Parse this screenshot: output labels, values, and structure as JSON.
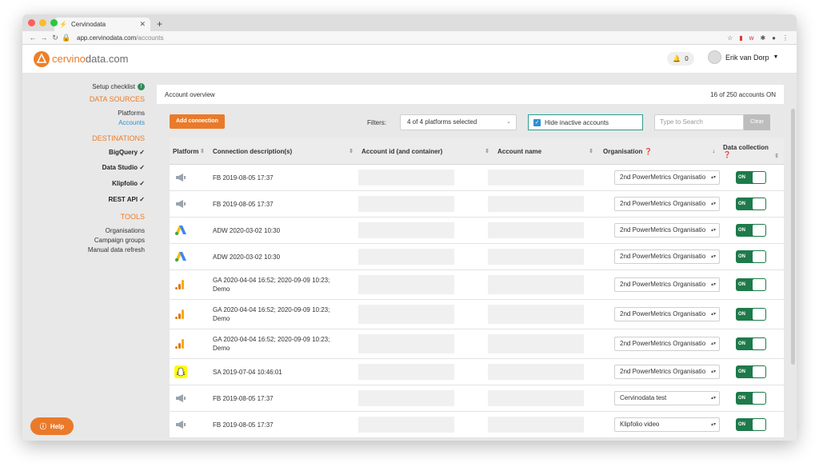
{
  "browser": {
    "tab_title": "Cervinodata",
    "url_host": "app.cervinodata.com",
    "url_path": "/accounts"
  },
  "header": {
    "logo_part1": "cervino",
    "logo_part2": "data.com",
    "notifications_count": "0",
    "user_name": "Erik van Dorp"
  },
  "sidebar": {
    "setup_checklist": "Setup checklist",
    "data_sources": "DATA SOURCES",
    "platforms": "Platforms",
    "accounts": "Accounts",
    "destinations": "DESTINATIONS",
    "bigquery": "BigQuery",
    "data_studio": "Data Studio",
    "klipfolio": "Klipfolio",
    "rest_api": "REST API",
    "tools": "TOOLS",
    "organisations": "Organisations",
    "campaign_groups": "Campaign groups",
    "manual_refresh": "Manual data refresh",
    "help": "Help"
  },
  "main": {
    "title": "Account overview",
    "accounts_on": "16 of 250 accounts ON",
    "add_connection": "Add connection",
    "filters_label": "Filters:",
    "platforms_filter": "4 of 4 platforms selected",
    "hide_inactive": "Hide inactive accounts",
    "search_placeholder": "Type to Search",
    "clear": "Clear"
  },
  "table": {
    "headers": {
      "platform": "Platform",
      "connection": "Connection description(s)",
      "account_id": "Account id (and container)",
      "account_name": "Account name",
      "organisation": "Organisation",
      "data_collection": "Data collection"
    },
    "rows": [
      {
        "platform": "facebook",
        "connection": "FB 2019-08-05 17:37",
        "connection2": "",
        "organisation": "2nd PowerMetrics Organisatio",
        "status": "ON"
      },
      {
        "platform": "facebook",
        "connection": "FB 2019-08-05 17:37",
        "connection2": "",
        "organisation": "2nd PowerMetrics Organisatio",
        "status": "ON"
      },
      {
        "platform": "google-ads",
        "connection": "ADW 2020-03-02 10:30",
        "connection2": "",
        "organisation": "2nd PowerMetrics Organisatio",
        "status": "ON"
      },
      {
        "platform": "google-ads",
        "connection": "ADW 2020-03-02 10:30",
        "connection2": "",
        "organisation": "2nd PowerMetrics Organisatio",
        "status": "ON"
      },
      {
        "platform": "google-analytics",
        "connection": "GA 2020-04-04 16:52; 2020-09-09 10:23;",
        "connection2": "Demo",
        "organisation": "2nd PowerMetrics Organisatio",
        "status": "ON"
      },
      {
        "platform": "google-analytics",
        "connection": "GA 2020-04-04 16:52; 2020-09-09 10:23;",
        "connection2": "Demo",
        "organisation": "2nd PowerMetrics Organisatio",
        "status": "ON"
      },
      {
        "platform": "google-analytics",
        "connection": "GA 2020-04-04 16:52; 2020-09-09 10:23;",
        "connection2": "Demo",
        "organisation": "2nd PowerMetrics Organisatio",
        "status": "ON"
      },
      {
        "platform": "snapchat",
        "connection": "SA 2019-07-04 10:46:01",
        "connection2": "",
        "organisation": "2nd PowerMetrics Organisatio",
        "status": "ON"
      },
      {
        "platform": "facebook",
        "connection": "FB 2019-08-05 17:37",
        "connection2": "",
        "organisation": "Cervinodata test",
        "status": "ON"
      },
      {
        "platform": "facebook",
        "connection": "FB 2019-08-05 17:37",
        "connection2": "",
        "organisation": "Klipfolio video",
        "status": "ON"
      }
    ]
  }
}
